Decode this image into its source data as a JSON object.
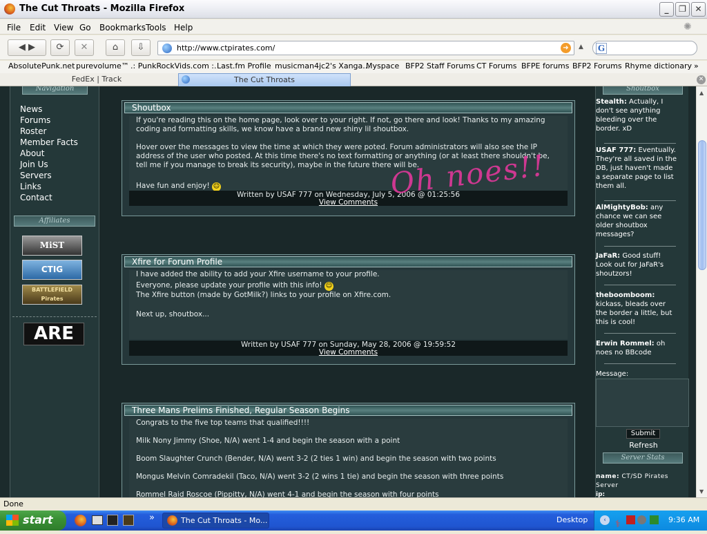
{
  "window": {
    "title": "The Cut Throats - Mozilla Firefox"
  },
  "menu": [
    "File",
    "Edit",
    "View",
    "Go",
    "Bookmarks",
    "Tools",
    "Help"
  ],
  "nav": {
    "url": "http://www.ctpirates.com/",
    "search_letter": "G"
  },
  "bookmarks": [
    "AbsolutePunk.net",
    "purevolume™",
    ".: PunkRockVids.com :.",
    "Last.fm Profile",
    "musicman4jc2's Xanga...",
    "Myspace",
    "BFP2 Staff Forums",
    "CT Forums",
    "BFPE forums",
    "BFP2 Forums",
    "Rhyme dictionary",
    "»"
  ],
  "tabs": [
    {
      "label": "FedEx | Track"
    },
    {
      "label": "The Cut Throats"
    }
  ],
  "left": {
    "nav_heading": "Navigation",
    "nav_items": [
      "News",
      "Forums",
      "Roster",
      "Member Facts",
      "About",
      "Join Us",
      "Servers",
      "Links",
      "Contact"
    ],
    "affiliates_heading": "Affiliates",
    "affiliates": [
      "MiST",
      "CTIG",
      "BATTLEFIELD Pirates"
    ],
    "banner": "ARE"
  },
  "posts": [
    {
      "title": "Shoutbox",
      "paragraphs": [
        "If you're reading this on the home page, look over to your right. If not, go there and look! Thanks to my amazing coding and formatting skills, we know have a brand new shiny lil shoutbox.",
        "Hover over the messages to view the time at which they were poted. Forum administrators will also see the IP address of the user who posted. At this time there's no text formatting or anything (or at least there shouldn't be, tell me if you manage to break its security), maybe in the future there will be.",
        "Have fun and enjoy!"
      ],
      "footer": "Written by USAF 777 on Wednesday, July 5, 2006 @ 01:25:56",
      "comments": "View Comments",
      "scribble": "Oh noes!!"
    },
    {
      "title": "Xfire for Forum Profile",
      "paragraphs": [
        "I have added the ability to add your Xfire username to your profile.",
        "Everyone, please update your profile with this info!",
        "The Xfire button (made by GotMilk?) links to your profile on Xfire.com.",
        "Next up, shoutbox..."
      ],
      "footer": "Written by USAF 777 on Sunday, May 28, 2006 @ 19:59:52",
      "comments": "View Comments"
    },
    {
      "title": "Three Mans Prelims Finished, Regular Season Begins",
      "paragraphs": [
        "Congrats to the five top teams that qualified!!!!",
        "Milk Nony Jimmy (Shoe, N/A) went 1-4 and begin the season with a point",
        "Boom Slaughter Crunch (Bender, N/A) went 3-2 (2 ties 1 win) and begin the season with two points",
        "Mongus Melvin Comradekil (Taco, N/A) went 3-2 (2 wins 1 tie) and begin the season with three points",
        "Rommel Raid Roscoe (Pippitty, N/A) went 4-1 and begin the season with four points"
      ]
    }
  ],
  "shoutbox": {
    "heading": "Shoutbox",
    "messages": [
      {
        "name": "Stealth:",
        "text": "Actually, I don't see anything bleeding over the border. xD"
      },
      {
        "name": "USAF 777:",
        "text": "Eventually. They're all saved in the DB, just haven't made a separate page to list them all."
      },
      {
        "name": "AlMightyBob:",
        "text": "any chance we can see older shoutbox messages?"
      },
      {
        "name": "JaFaR:",
        "text": "Good stuff! Look out for JaFaR's shoutzors!"
      },
      {
        "name": "theboomboom:",
        "text": "kickass, bleads over the border a little, but this is cool!"
      },
      {
        "name": "Erwin Rommel:",
        "text": "oh noes no BBcode"
      }
    ],
    "message_label": "Message:",
    "submit": "Submit",
    "refresh": "Refresh"
  },
  "server": {
    "heading": "Server Stats",
    "name_label": "name:",
    "name_value": "CT/SD Pirates Server",
    "ip_label": "ip:"
  },
  "status": "Done",
  "taskbar": {
    "start": "start",
    "item": "The Cut Throats - Mo...",
    "desktop": "Desktop",
    "clock": "9:36 AM"
  }
}
